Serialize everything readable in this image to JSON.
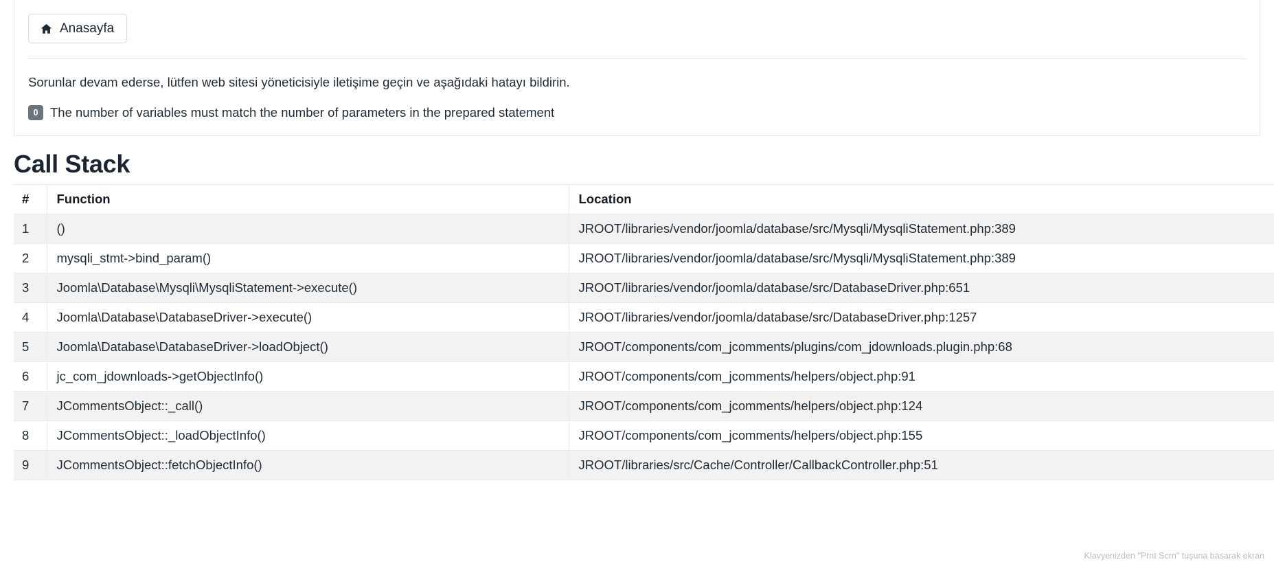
{
  "error_panel": {
    "home_button_label": "Anasayfa",
    "home_icon": "home-icon",
    "hint_text": "Sorunlar devam ederse, lütfen web sitesi yöneticisiyle iletişime geçin ve aşağıdaki hatayı bildirin.",
    "error_badge": "0",
    "error_message": "The number of variables must match the number of parameters in the prepared statement"
  },
  "call_stack": {
    "title": "Call Stack",
    "columns": [
      "#",
      "Function",
      "Location"
    ],
    "rows": [
      {
        "num": "1",
        "fn": "()",
        "loc": "JROOT/libraries/vendor/joomla/database/src/Mysqli/MysqliStatement.php:389"
      },
      {
        "num": "2",
        "fn": "mysqli_stmt->bind_param()",
        "loc": "JROOT/libraries/vendor/joomla/database/src/Mysqli/MysqliStatement.php:389"
      },
      {
        "num": "3",
        "fn": "Joomla\\Database\\Mysqli\\MysqliStatement->execute()",
        "loc": "JROOT/libraries/vendor/joomla/database/src/DatabaseDriver.php:651"
      },
      {
        "num": "4",
        "fn": "Joomla\\Database\\DatabaseDriver->execute()",
        "loc": "JROOT/libraries/vendor/joomla/database/src/DatabaseDriver.php:1257"
      },
      {
        "num": "5",
        "fn": "Joomla\\Database\\DatabaseDriver->loadObject()",
        "loc": "JROOT/components/com_jcomments/plugins/com_jdownloads.plugin.php:68"
      },
      {
        "num": "6",
        "fn": "jc_com_jdownloads->getObjectInfo()",
        "loc": "JROOT/components/com_jcomments/helpers/object.php:91"
      },
      {
        "num": "7",
        "fn": "JCommentsObject::_call()",
        "loc": "JROOT/components/com_jcomments/helpers/object.php:124"
      },
      {
        "num": "8",
        "fn": "JCommentsObject::_loadObjectInfo()",
        "loc": "JROOT/components/com_jcomments/helpers/object.php:155"
      },
      {
        "num": "9",
        "fn": "JCommentsObject::fetchObjectInfo()",
        "loc": "JROOT/libraries/src/Cache/Controller/CallbackController.php:51"
      }
    ]
  },
  "watermark": {
    "text": "Klavyenizden \"Prnt Scrn\" tuşuna basarak ekran"
  },
  "colors": {
    "badge_bg": "#6c757d",
    "row_stripe": "#f2f2f3",
    "border": "#e6e8ea",
    "text": "#1f2a33"
  }
}
